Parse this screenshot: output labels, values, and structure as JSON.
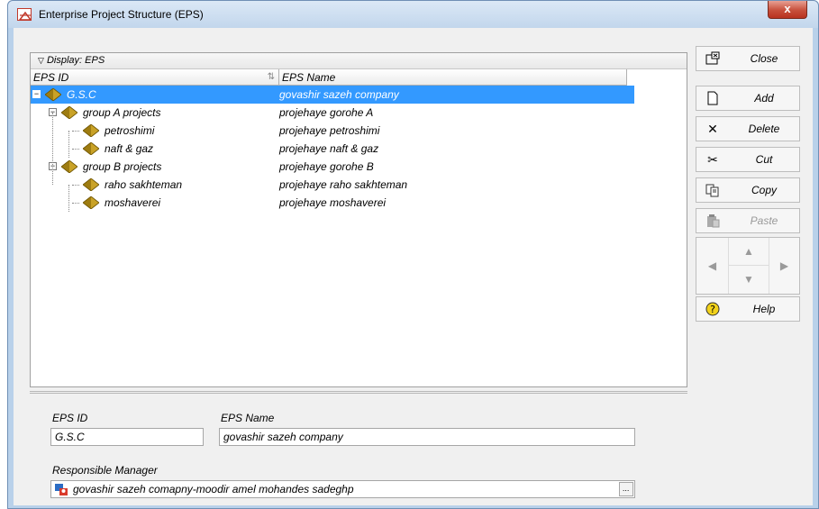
{
  "window": {
    "title": "Enterprise Project Structure (EPS)",
    "close_glyph": "x"
  },
  "grid": {
    "display_label": "Display: EPS",
    "columns": [
      "EPS ID",
      "EPS Name"
    ],
    "rows": [
      {
        "id": "G.S.C",
        "name": "govashir sazeh company",
        "level": 0,
        "expander": "−",
        "selected": true
      },
      {
        "id": "group A projects",
        "name": "projehaye gorohe A",
        "level": 1,
        "expander": "−",
        "selected": false
      },
      {
        "id": "petroshimi",
        "name": "projehaye petroshimi",
        "level": 2,
        "expander": "",
        "selected": false
      },
      {
        "id": "naft & gaz",
        "name": "projehaye naft & gaz",
        "level": 2,
        "expander": "",
        "selected": false
      },
      {
        "id": "group B projects",
        "name": "projehaye gorohe B",
        "level": 1,
        "expander": "−",
        "selected": false
      },
      {
        "id": "raho sakhteman",
        "name": "projehaye raho sakhteman",
        "level": 2,
        "expander": "",
        "selected": false
      },
      {
        "id": "moshaverei",
        "name": "projehaye moshaverei",
        "level": 2,
        "expander": "",
        "selected": false
      }
    ]
  },
  "detail": {
    "eps_id_label": "EPS ID",
    "eps_id_value": "G.S.C",
    "eps_name_label": "EPS Name",
    "eps_name_value": "govashir sazeh company",
    "manager_label": "Responsible Manager",
    "manager_value": "govashir sazeh comapny-moodir amel mohandes sadeghp",
    "dots_label": "..."
  },
  "buttons": {
    "close": "Close",
    "add": "Add",
    "delete": "Delete",
    "cut": "Cut",
    "copy": "Copy",
    "paste": "Paste",
    "help": "Help"
  },
  "colors": {
    "selection": "#3399ff",
    "node_icon": "#c9a227"
  }
}
